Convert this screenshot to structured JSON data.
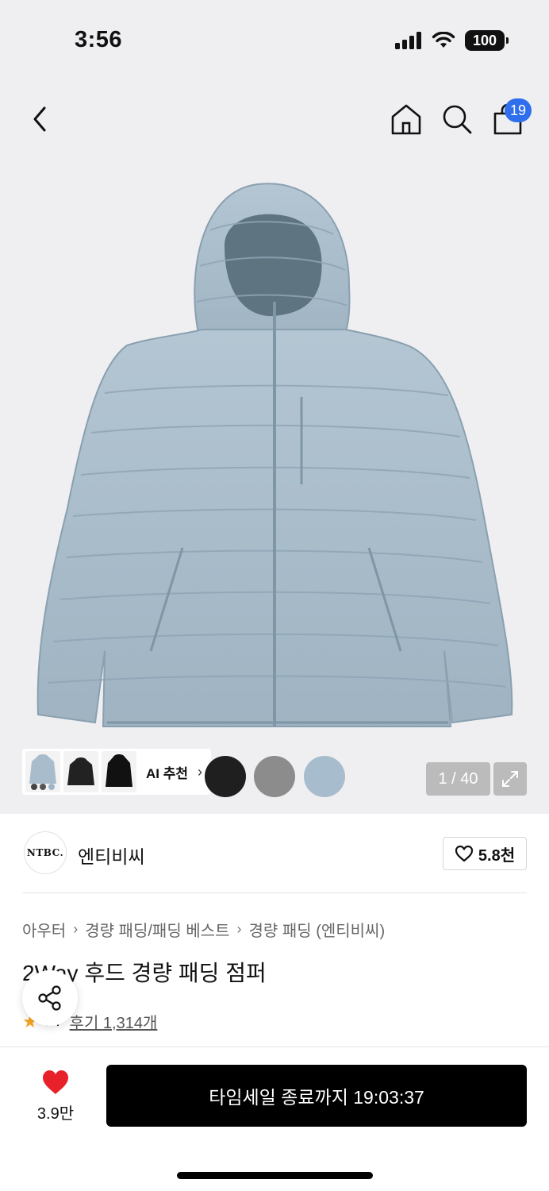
{
  "status_bar": {
    "time": "3:56",
    "battery": "100"
  },
  "nav": {
    "cart_count": "19"
  },
  "gallery": {
    "ai_label": "AI 추천",
    "counter": "1 / 40",
    "swatches": [
      "#1f1f1f",
      "#8c8c8c",
      "#a7bccd"
    ]
  },
  "brand": {
    "logo_text": "NTBC.",
    "name": "엔티비씨",
    "likes": "5.8천"
  },
  "breadcrumb": [
    "아우터",
    "경량 패딩/패딩 베스트",
    "경량 패딩 (엔티비씨)"
  ],
  "product": {
    "title": "2Way 후드 경량 패딩 점퍼",
    "rating": "4.7",
    "reviews": "후기 1,314개"
  },
  "bottom_bar": {
    "wish_count": "3.9만",
    "buy_label": "타임세일 종료까지 19:03:37"
  },
  "colors": {
    "badge": "#2f6fed",
    "heart": "#e8202a",
    "jacket": "#a9bccb"
  }
}
